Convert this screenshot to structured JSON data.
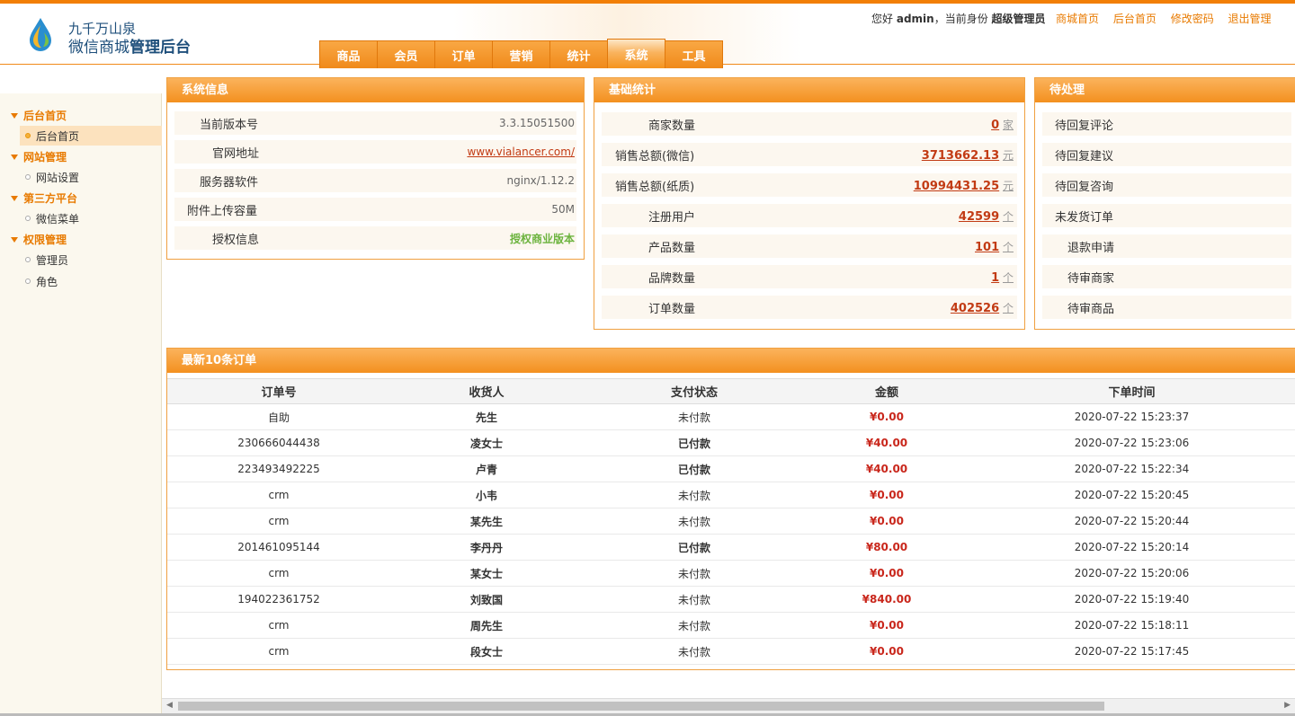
{
  "header": {
    "brand_line1": "九千万山泉",
    "brand_line2_normal": "微信商城",
    "brand_line2_bold": "管理后台",
    "greeting_prefix": "您好",
    "username": "admin",
    "role_prefix": "，当前身份",
    "role": "超级管理员",
    "links": [
      "商城首页",
      "后台首页",
      "修改密码",
      "退出管理"
    ],
    "nav_tabs": [
      "商品",
      "会员",
      "订单",
      "营销",
      "统计",
      "系统",
      "工具"
    ],
    "active_tab": "系统"
  },
  "sidebar": {
    "groups": [
      {
        "title": "后台首页",
        "items": [
          "后台首页"
        ]
      },
      {
        "title": "网站管理",
        "items": [
          "网站设置"
        ]
      },
      {
        "title": "第三方平台",
        "items": [
          "微信菜单"
        ]
      },
      {
        "title": "权限管理",
        "items": [
          "管理员",
          "角色"
        ]
      }
    ],
    "active_item": "后台首页"
  },
  "system_info": {
    "title": "系统信息",
    "rows": [
      {
        "label": "当前版本号",
        "value": "3.3.15051500"
      },
      {
        "label": "官网地址",
        "value": "www.vialancer.com/"
      },
      {
        "label": "服务器软件",
        "value": "nginx/1.12.2"
      },
      {
        "label": "附件上传容量",
        "value": "50M"
      },
      {
        "label": "授权信息",
        "value": "授权商业版本"
      }
    ]
  },
  "basic_stats": {
    "title": "基础统计",
    "rows": [
      {
        "label": "商家数量",
        "value": "0",
        "unit": "家"
      },
      {
        "label": "销售总额(微信)",
        "value": "3713662.13",
        "unit": "元"
      },
      {
        "label": "销售总额(纸质)",
        "value": "10994431.25",
        "unit": "元"
      },
      {
        "label": "注册用户",
        "value": "42599",
        "unit": "个"
      },
      {
        "label": "产品数量",
        "value": "101",
        "unit": "个"
      },
      {
        "label": "品牌数量",
        "value": "1",
        "unit": "个"
      },
      {
        "label": "订单数量",
        "value": "402526",
        "unit": "个"
      }
    ]
  },
  "pending": {
    "title": "待处理",
    "rows": [
      "待回复评论",
      "待回复建议",
      "待回复咨询",
      "未发货订单",
      "退款申请",
      "待审商家",
      "待审商品"
    ]
  },
  "orders": {
    "title": "最新10条订单",
    "columns": [
      "订单号",
      "收货人",
      "支付状态",
      "金额",
      "下单时间"
    ],
    "rows": [
      {
        "id": "自助",
        "name": "先生",
        "status": "未付款",
        "amount": "¥0.00",
        "time": "2020-07-22 15:23:37"
      },
      {
        "id": "230666044438",
        "name": "凌女士",
        "status": "已付款",
        "amount": "¥40.00",
        "time": "2020-07-22 15:23:06"
      },
      {
        "id": "223493492225",
        "name": "卢青",
        "status": "已付款",
        "amount": "¥40.00",
        "time": "2020-07-22 15:22:34"
      },
      {
        "id": "crm",
        "name": "小韦",
        "status": "未付款",
        "amount": "¥0.00",
        "time": "2020-07-22 15:20:45"
      },
      {
        "id": "crm",
        "name": "某先生",
        "status": "未付款",
        "amount": "¥0.00",
        "time": "2020-07-22 15:20:44"
      },
      {
        "id": "201461095144",
        "name": "李丹丹",
        "status": "已付款",
        "amount": "¥80.00",
        "time": "2020-07-22 15:20:14"
      },
      {
        "id": "crm",
        "name": "某女士",
        "status": "未付款",
        "amount": "¥0.00",
        "time": "2020-07-22 15:20:06"
      },
      {
        "id": "194022361752",
        "name": "刘致国",
        "status": "未付款",
        "amount": "¥840.00",
        "time": "2020-07-22 15:19:40"
      },
      {
        "id": "crm",
        "name": "周先生",
        "status": "未付款",
        "amount": "¥0.00",
        "time": "2020-07-22 15:18:11"
      },
      {
        "id": "crm",
        "name": "段女士",
        "status": "未付款",
        "amount": "¥0.00",
        "time": "2020-07-22 15:17:45"
      }
    ]
  },
  "icons": {
    "logo": "water-drop-logo-icon",
    "group": "triangle-down-icon",
    "item": "circle-bullet-icon"
  },
  "colors": {
    "accent": "#f08a1a",
    "link_red": "#c23b14",
    "green": "#6cb33e"
  }
}
